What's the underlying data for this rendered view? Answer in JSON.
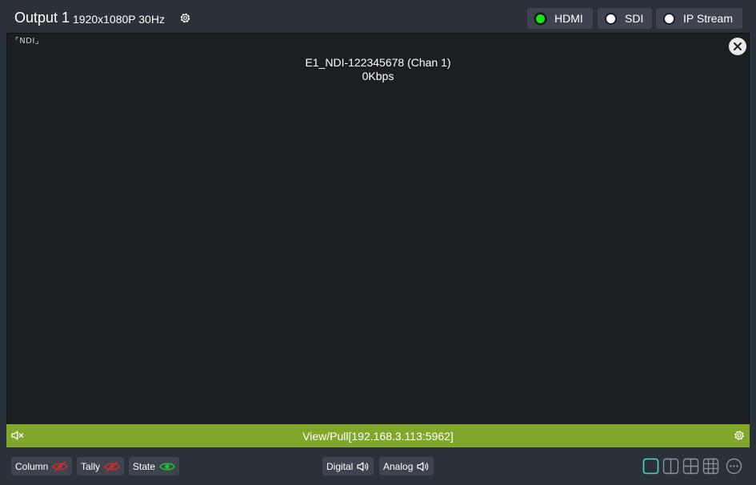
{
  "header": {
    "title": "Output 1",
    "resolution": "1920x1080P 30Hz",
    "outputs": [
      {
        "label": "HDMI",
        "selected": true
      },
      {
        "label": "SDI",
        "selected": false
      },
      {
        "label": "IP Stream",
        "selected": false
      }
    ]
  },
  "preview": {
    "tag": "NDI",
    "source_name": "E1_NDI-122345678 (Chan 1)",
    "bitrate": "0Kbps"
  },
  "status_bar": {
    "text": "View/Pull[192.168.3.113:5962]",
    "color": "#80a72a"
  },
  "toolbar": {
    "column_label": "Column",
    "tally_label": "Tally",
    "state_label": "State",
    "digital_label": "Digital",
    "analog_label": "Analog",
    "active_layout": "single",
    "colors": {
      "hidden": "#d42a2a",
      "visible": "#22c033",
      "active_layout": "#4fd6bb"
    }
  }
}
